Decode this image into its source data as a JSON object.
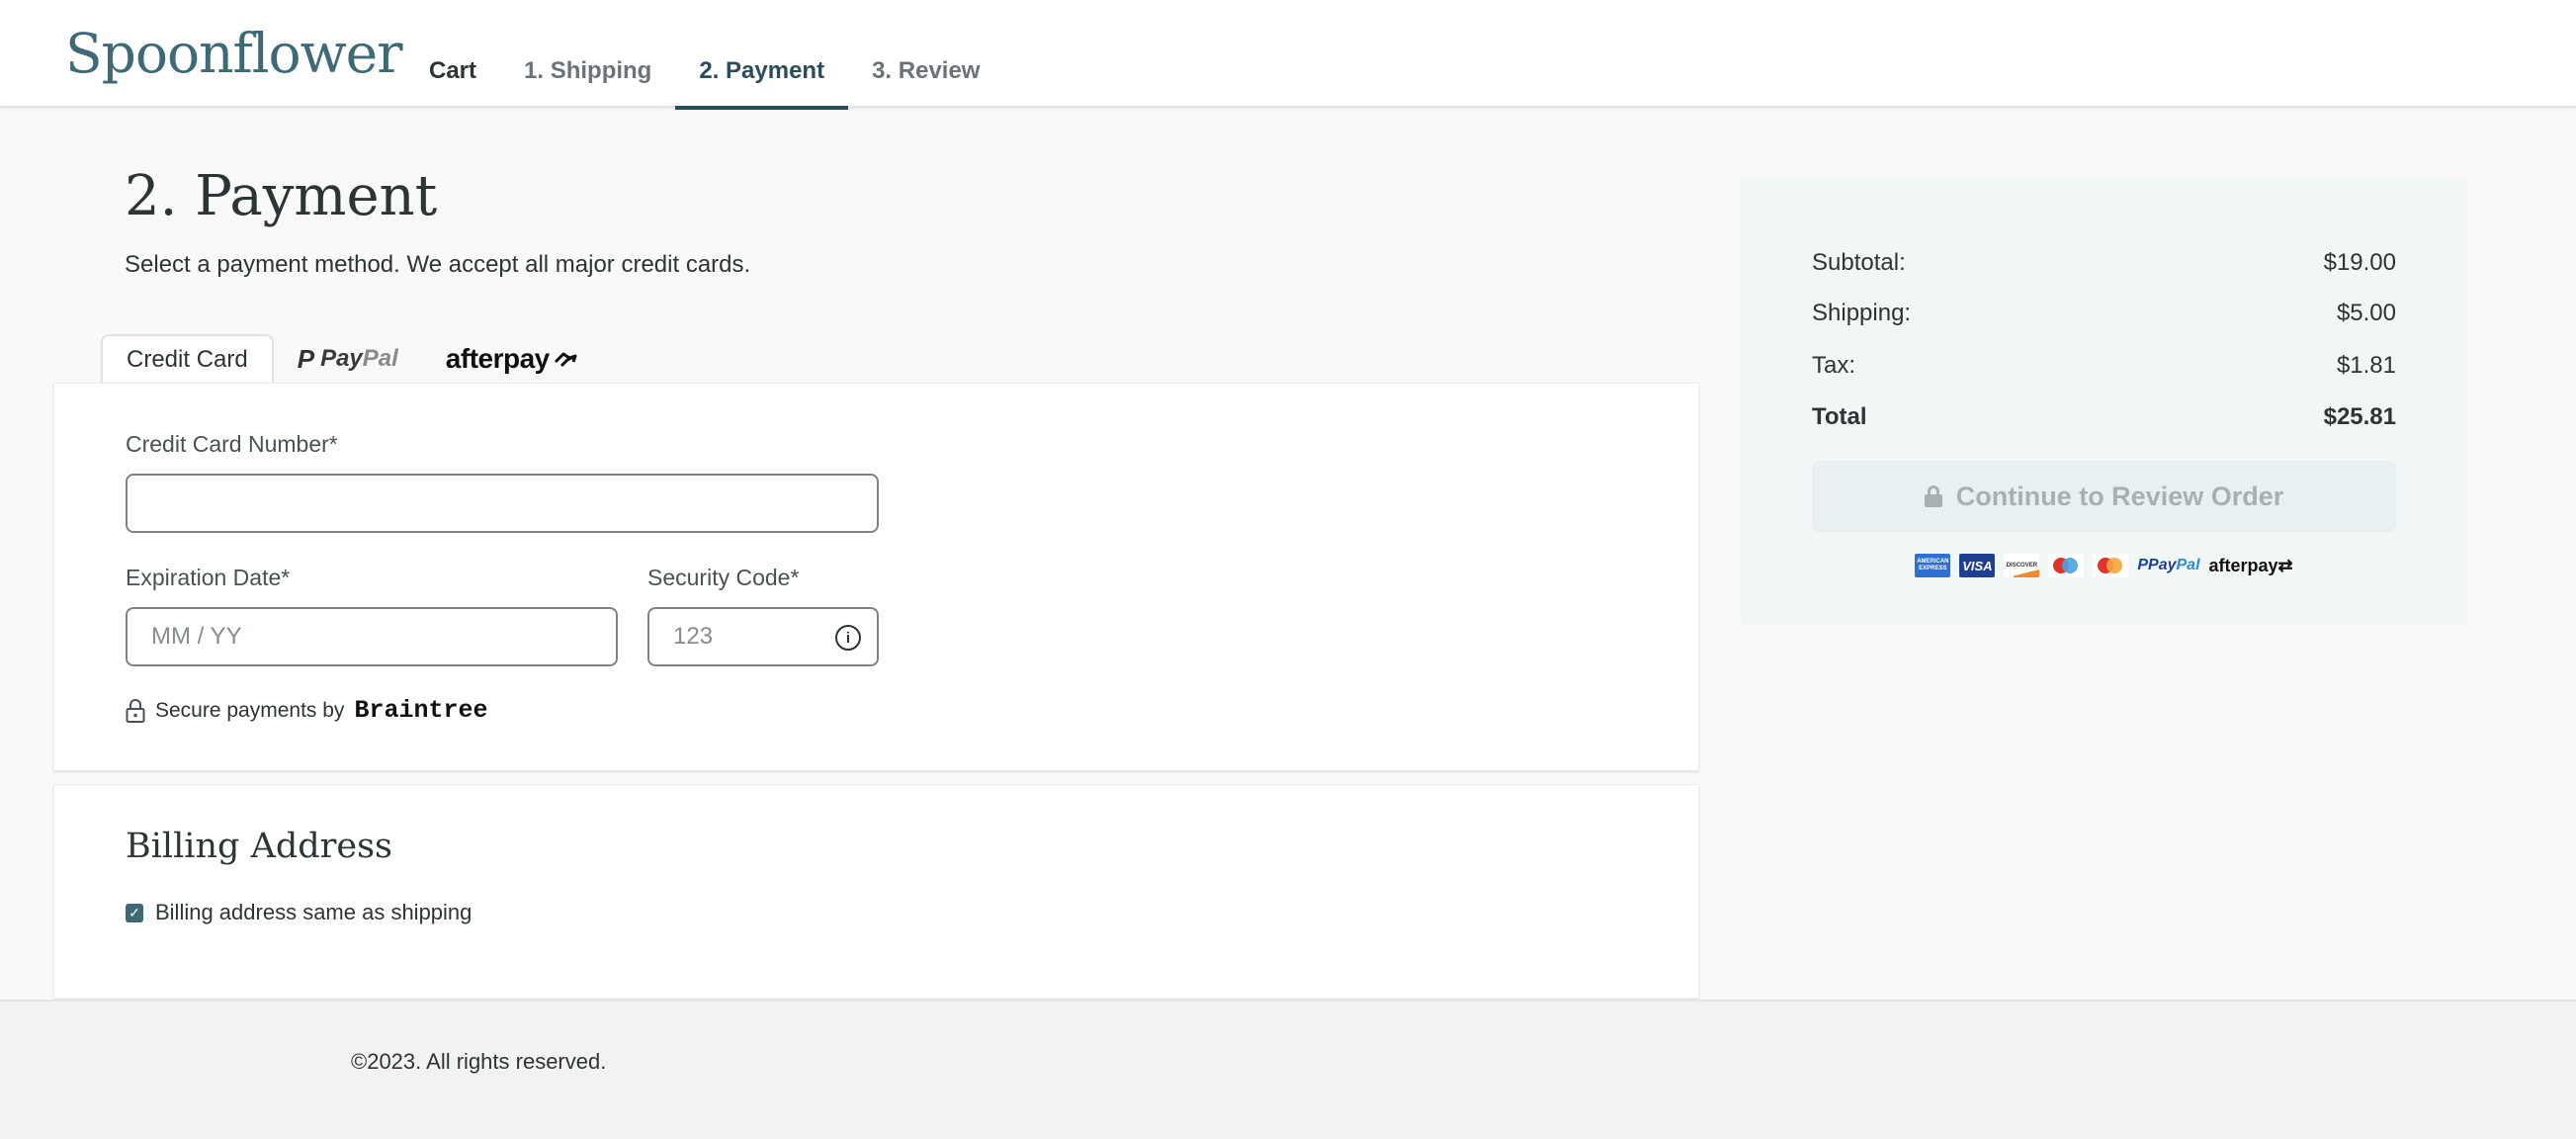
{
  "header": {
    "logo": "Spoonflower",
    "nav": [
      {
        "label": "Cart",
        "state": "link"
      },
      {
        "label": "1. Shipping",
        "state": "done"
      },
      {
        "label": "2. Payment",
        "state": "active"
      },
      {
        "label": "3. Review",
        "state": "upcoming"
      }
    ]
  },
  "page": {
    "title": "2. Payment",
    "subtitle": "Select a payment method. We accept all major credit cards."
  },
  "payment_tabs": {
    "credit_card": "Credit Card",
    "paypal_pay": "Pay",
    "paypal_pal": "Pal",
    "afterpay": "afterpay",
    "selected": "Credit Card"
  },
  "credit_card_form": {
    "card_number_label": "Credit Card Number*",
    "card_number_value": "",
    "expiration_label": "Expiration Date*",
    "expiration_placeholder": "MM / YY",
    "security_label": "Security Code*",
    "security_placeholder": "123",
    "info_icon": "i",
    "secure_text": "Secure payments by",
    "secure_brand": "Braintree"
  },
  "billing": {
    "title": "Billing Address",
    "same_as_shipping_label": "Billing address same as shipping",
    "same_as_shipping_checked": true,
    "check_glyph": "✓"
  },
  "summary": {
    "rows": [
      {
        "label": "Subtotal:",
        "value": "$19.00"
      },
      {
        "label": "Shipping:",
        "value": "$5.00"
      },
      {
        "label": "Tax:",
        "value": "$1.81"
      },
      {
        "label": "Total",
        "value": "$25.81"
      }
    ],
    "continue_button": "Continue to Review Order",
    "continue_disabled": true,
    "accepted_logos": {
      "amex": "AMERICAN EXPRESS",
      "visa": "VISA",
      "discover": "DISCOVER",
      "maestro": "maestro",
      "mastercard": "mastercard",
      "paypal_pay": "Pay",
      "paypal_pal": "Pal",
      "afterpay": "afterpay"
    }
  },
  "footer": {
    "copyright": "©2023. All rights reserved."
  },
  "colors": {
    "brand": "#3e6a75",
    "active_nav": "#2c4c5c",
    "summary_bg": "#f1f6f7",
    "button_disabled_bg": "#e9f0f1",
    "button_disabled_text": "#a8b0b4"
  }
}
